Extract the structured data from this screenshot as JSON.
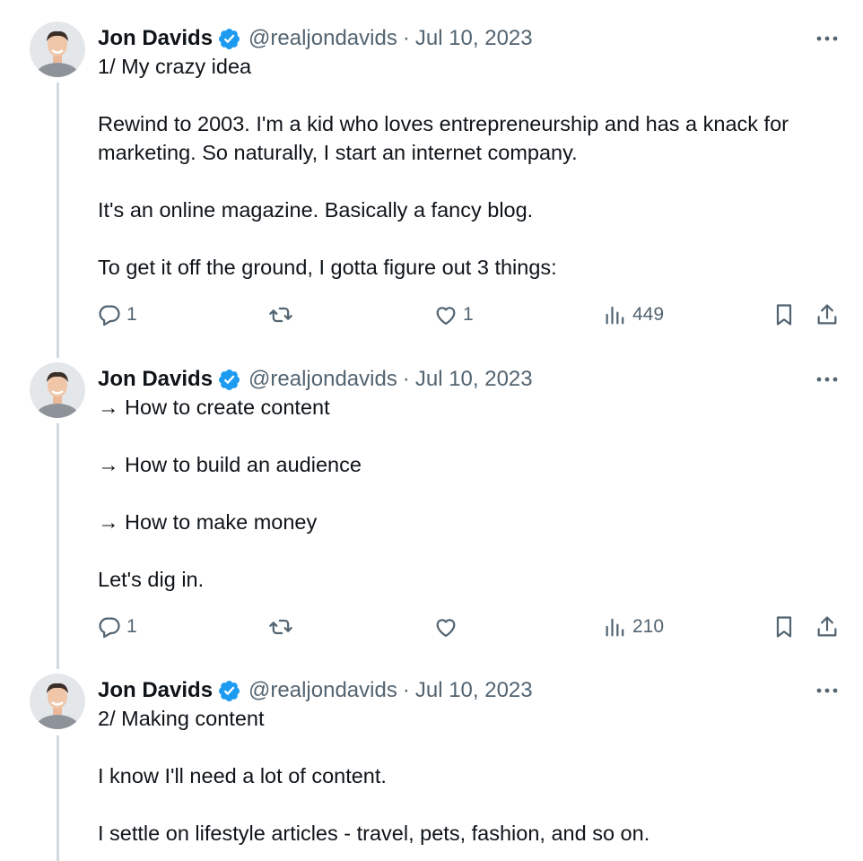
{
  "tweets": [
    {
      "name": "Jon Davids",
      "handle": "@realjondavids",
      "separator": "·",
      "date": "Jul 10, 2023",
      "lines": [
        "1/ My crazy idea",
        "",
        "Rewind to 2003. I'm a kid who loves entrepreneurship and has a knack for",
        "marketing. So naturally, I start an internet company.",
        "",
        "It's an online magazine. Basically a fancy blog.",
        "",
        "To get it off the ground, I gotta figure out 3 things:"
      ],
      "replies": "1",
      "retweets": "",
      "likes": "1",
      "views": "449"
    },
    {
      "name": "Jon Davids",
      "handle": "@realjondavids",
      "separator": "·",
      "date": "Jul 10, 2023",
      "lines": [
        "→ How to create content",
        "",
        "→ How to build an audience",
        "",
        "→ How to make money",
        "",
        "Let's dig in."
      ],
      "replies": "1",
      "retweets": "",
      "likes": "",
      "views": "210"
    },
    {
      "name": "Jon Davids",
      "handle": "@realjondavids",
      "separator": "·",
      "date": "Jul 10, 2023",
      "lines": [
        "2/ Making content",
        "",
        "I know I'll need a lot of content.",
        "",
        "I settle on lifestyle articles - travel, pets, fashion, and so on."
      ]
    }
  ],
  "colors": {
    "verified": "#1d9bf0",
    "icon": "#536471",
    "thread_line": "#cfd9de",
    "text": "#0f1419"
  },
  "icons": [
    "verified-badge-icon",
    "more-icon",
    "reply-icon",
    "retweet-icon",
    "like-icon",
    "views-icon",
    "bookmark-icon",
    "share-icon"
  ]
}
